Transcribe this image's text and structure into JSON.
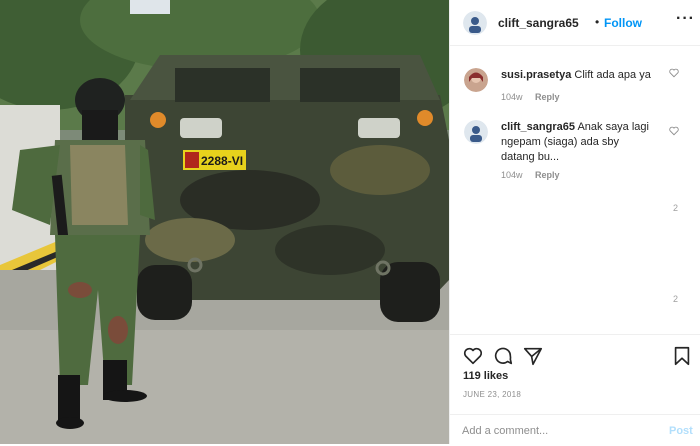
{
  "post": {
    "author": "clift_sangra65",
    "follow_label": "Follow",
    "separator": "•",
    "more_icon": "more-horizontal-icon",
    "photo": {
      "plate_text": "2288-VI"
    }
  },
  "comments": [
    {
      "username": "susi.prasetya",
      "text": "Clift ada apa ya",
      "age": "104w",
      "reply_label": "Reply"
    },
    {
      "username": "clift_sangra65",
      "text": "Anak saya lagi ngepam (siaga) ada sby datang bu...",
      "age": "104w",
      "reply_label": "Reply"
    }
  ],
  "scroll_markers": [
    "2",
    "2"
  ],
  "actions": {
    "likes": "119 likes",
    "date": "JUNE 23, 2018"
  },
  "add_comment": {
    "placeholder": "Add a comment...",
    "post_label": "Post"
  },
  "colors": {
    "link_blue": "#0095f6",
    "post_disabled": "#b2dffc",
    "muted": "#8e8e8e"
  }
}
